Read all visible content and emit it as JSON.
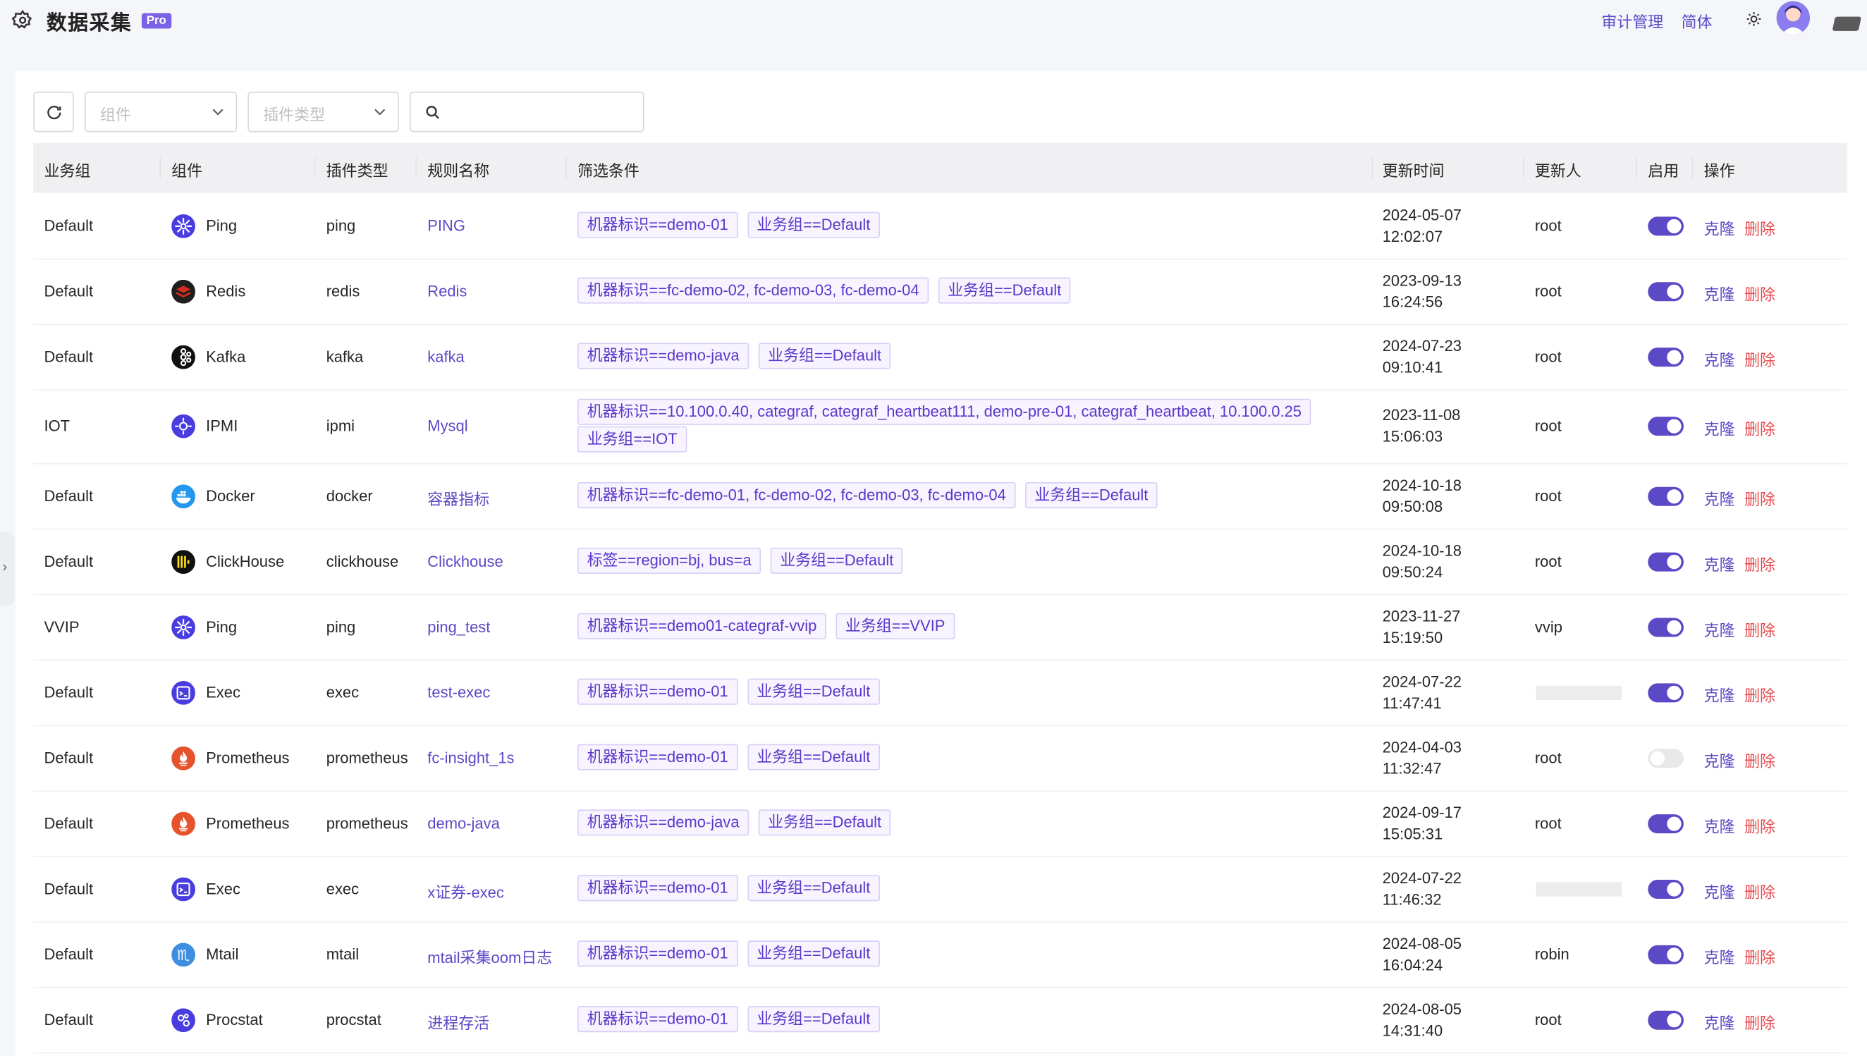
{
  "header": {
    "title": "数据采集",
    "badge": "Pro",
    "links": [
      "审计管理",
      "简体"
    ]
  },
  "filters": {
    "component_placeholder": "组件",
    "plugin_type_placeholder": "插件类型"
  },
  "table": {
    "columns": [
      "业务组",
      "组件",
      "插件类型",
      "规则名称",
      "筛选条件",
      "更新时间",
      "更新人",
      "启用",
      "操作"
    ],
    "actions": {
      "clone": "克隆",
      "delete": "删除"
    },
    "rows": [
      {
        "group": "Default",
        "component": "Ping",
        "icon": "ping-icon",
        "plugin": "ping",
        "rule": "PING",
        "tags": [
          "机器标识==demo-01",
          "业务组==Default"
        ],
        "date": "2024-05-07",
        "time": "12:02:07",
        "user": "root",
        "enabled": true
      },
      {
        "group": "Default",
        "component": "Redis",
        "icon": "redis-icon",
        "plugin": "redis",
        "rule": "Redis",
        "tags": [
          "机器标识==fc-demo-02, fc-demo-03, fc-demo-04",
          "业务组==Default"
        ],
        "date": "2023-09-13",
        "time": "16:24:56",
        "user": "root",
        "enabled": true
      },
      {
        "group": "Default",
        "component": "Kafka",
        "icon": "kafka-icon",
        "plugin": "kafka",
        "rule": "kafka",
        "tags": [
          "机器标识==demo-java",
          "业务组==Default"
        ],
        "date": "2024-07-23",
        "time": "09:10:41",
        "user": "root",
        "enabled": true
      },
      {
        "group": "IOT",
        "component": "IPMI",
        "icon": "ipmi-icon",
        "plugin": "ipmi",
        "rule": "Mysql",
        "tags": [
          "机器标识==10.100.0.40, categraf, categraf_heartbeat111, demo-pre-01, categraf_heartbeat, 10.100.0.25",
          "业务组==IOT"
        ],
        "date": "2023-11-08",
        "time": "15:06:03",
        "user": "root",
        "enabled": true
      },
      {
        "group": "Default",
        "component": "Docker",
        "icon": "docker-icon",
        "plugin": "docker",
        "rule": "容器指标",
        "tags": [
          "机器标识==fc-demo-01, fc-demo-02, fc-demo-03, fc-demo-04",
          "业务组==Default"
        ],
        "date": "2024-10-18",
        "time": "09:50:08",
        "user": "root",
        "enabled": true
      },
      {
        "group": "Default",
        "component": "ClickHouse",
        "icon": "clickhouse-icon",
        "plugin": "clickhouse",
        "rule": "Clickhouse",
        "tags": [
          "标签==region=bj, bus=a",
          "业务组==Default"
        ],
        "date": "2024-10-18",
        "time": "09:50:24",
        "user": "root",
        "enabled": true
      },
      {
        "group": "VVIP",
        "component": "Ping",
        "icon": "ping-icon",
        "plugin": "ping",
        "rule": "ping_test",
        "tags": [
          "机器标识==demo01-categraf-vvip",
          "业务组==VVIP"
        ],
        "date": "2023-11-27",
        "time": "15:19:50",
        "user": "vvip",
        "enabled": true
      },
      {
        "group": "Default",
        "component": "Exec",
        "icon": "exec-icon",
        "plugin": "exec",
        "rule": "test-exec",
        "tags": [
          "机器标识==demo-01",
          "业务组==Default"
        ],
        "date": "2024-07-22",
        "time": "11:47:41",
        "user": "",
        "enabled": true
      },
      {
        "group": "Default",
        "component": "Prometheus",
        "icon": "prometheus-icon",
        "plugin": "prometheus",
        "rule": "fc-insight_1s",
        "tags": [
          "机器标识==demo-01",
          "业务组==Default"
        ],
        "date": "2024-04-03",
        "time": "11:32:47",
        "user": "root",
        "enabled": false
      },
      {
        "group": "Default",
        "component": "Prometheus",
        "icon": "prometheus-icon",
        "plugin": "prometheus",
        "rule": "demo-java",
        "tags": [
          "机器标识==demo-java",
          "业务组==Default"
        ],
        "date": "2024-09-17",
        "time": "15:05:31",
        "user": "root",
        "enabled": true
      },
      {
        "group": "Default",
        "component": "Exec",
        "icon": "exec-icon",
        "plugin": "exec",
        "rule": "x证券-exec",
        "tags": [
          "机器标识==demo-01",
          "业务组==Default"
        ],
        "date": "2024-07-22",
        "time": "11:46:32",
        "user": "",
        "enabled": true
      },
      {
        "group": "Default",
        "component": "Mtail",
        "icon": "mtail-icon",
        "plugin": "mtail",
        "rule": "mtail采集oom日志",
        "tags": [
          "机器标识==demo-01",
          "业务组==Default"
        ],
        "date": "2024-08-05",
        "time": "16:04:24",
        "user": "robin",
        "enabled": true
      },
      {
        "group": "Default",
        "component": "Procstat",
        "icon": "procstat-icon",
        "plugin": "procstat",
        "rule": "进程存活",
        "tags": [
          "机器标识==demo-01",
          "业务组==Default"
        ],
        "date": "2024-08-05",
        "time": "14:31:40",
        "user": "root",
        "enabled": true
      }
    ]
  }
}
